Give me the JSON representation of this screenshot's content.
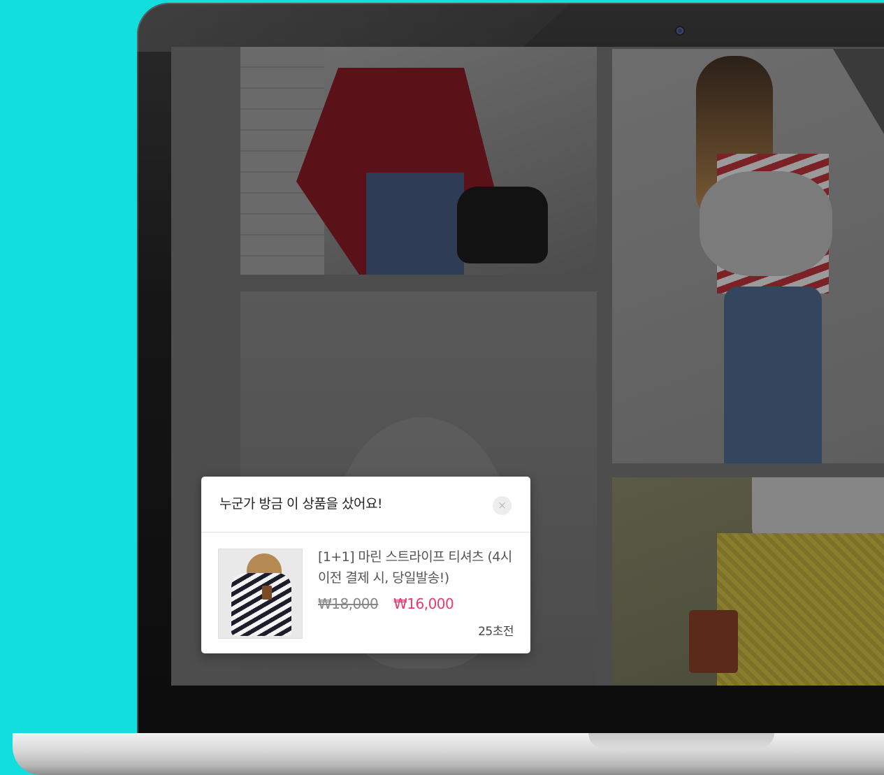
{
  "popup": {
    "title": "누군가 방금 이 상품을 샀어요!",
    "close_icon": "×",
    "product_name": "[1+1] 마린 스트라이프 티셔츠 (4시 이전 결제 시, 당일발송!)",
    "price_original": "₩18,000",
    "price_sale": "₩16,000",
    "time_ago": "25초전"
  },
  "colors": {
    "background": "#12dede",
    "sale_price": "#e83a6f"
  }
}
